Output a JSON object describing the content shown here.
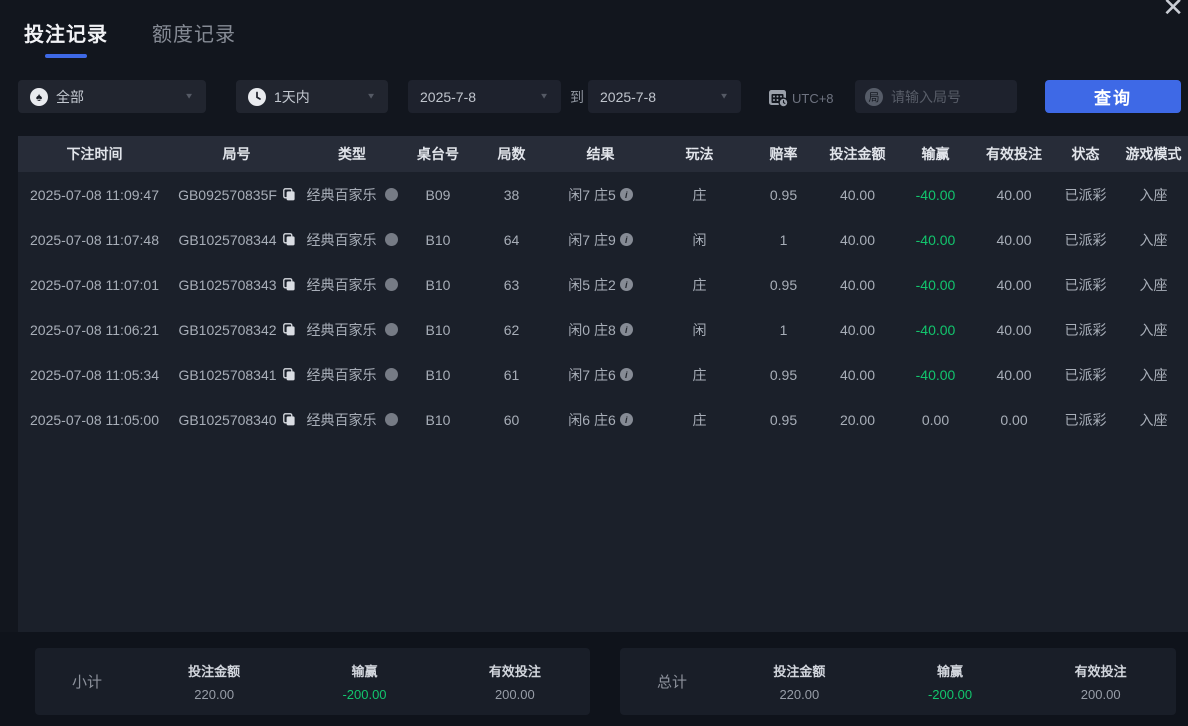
{
  "icons": {
    "close": "✕",
    "caret": "▼",
    "spade": "♠",
    "info": "i"
  },
  "colors": {
    "accent_blue": "#3e69e6",
    "loss_green": "#12c56d"
  },
  "tabs": [
    {
      "label": "投注记录",
      "active": true
    },
    {
      "label": "额度记录",
      "active": false
    }
  ],
  "filters": {
    "game_type_value": "全部",
    "time_range_value": "1天内",
    "date_from": "2025-7-8",
    "to_label": "到",
    "date_to": "2025-7-8",
    "timezone": "UTC+8",
    "round_icon_char": "局",
    "round_placeholder": "请输入局号",
    "query_label": "查询"
  },
  "table": {
    "headers": [
      "下注时间",
      "局号",
      "类型",
      "桌台号",
      "局数",
      "结果",
      "玩法",
      "赔率",
      "投注金额",
      "输赢",
      "有效投注",
      "状态",
      "游戏模式"
    ],
    "rows": [
      {
        "time": "2025-07-08 11:09:47",
        "round_id": "GB092570835F",
        "game_type": "经典百家乐",
        "table_no": "B09",
        "round_no": "38",
        "result": "闲7 庄5",
        "play": "庄",
        "odds": "0.95",
        "bet_amount": "40.00",
        "win_loss": "-40.00",
        "valid_bet": "40.00",
        "status": "已派彩",
        "mode": "入座"
      },
      {
        "time": "2025-07-08 11:07:48",
        "round_id": "GB1025708344",
        "game_type": "经典百家乐",
        "table_no": "B10",
        "round_no": "64",
        "result": "闲7 庄9",
        "play": "闲",
        "odds": "1",
        "bet_amount": "40.00",
        "win_loss": "-40.00",
        "valid_bet": "40.00",
        "status": "已派彩",
        "mode": "入座"
      },
      {
        "time": "2025-07-08 11:07:01",
        "round_id": "GB1025708343",
        "game_type": "经典百家乐",
        "table_no": "B10",
        "round_no": "63",
        "result": "闲5 庄2",
        "play": "庄",
        "odds": "0.95",
        "bet_amount": "40.00",
        "win_loss": "-40.00",
        "valid_bet": "40.00",
        "status": "已派彩",
        "mode": "入座"
      },
      {
        "time": "2025-07-08 11:06:21",
        "round_id": "GB1025708342",
        "game_type": "经典百家乐",
        "table_no": "B10",
        "round_no": "62",
        "result": "闲0 庄8",
        "play": "闲",
        "odds": "1",
        "bet_amount": "40.00",
        "win_loss": "-40.00",
        "valid_bet": "40.00",
        "status": "已派彩",
        "mode": "入座"
      },
      {
        "time": "2025-07-08 11:05:34",
        "round_id": "GB1025708341",
        "game_type": "经典百家乐",
        "table_no": "B10",
        "round_no": "61",
        "result": "闲7 庄6",
        "play": "庄",
        "odds": "0.95",
        "bet_amount": "40.00",
        "win_loss": "-40.00",
        "valid_bet": "40.00",
        "status": "已派彩",
        "mode": "入座"
      },
      {
        "time": "2025-07-08 11:05:00",
        "round_id": "GB1025708340",
        "game_type": "经典百家乐",
        "table_no": "B10",
        "round_no": "60",
        "result": "闲6 庄6",
        "play": "庄",
        "odds": "0.95",
        "bet_amount": "20.00",
        "win_loss": "0.00",
        "valid_bet": "0.00",
        "status": "已派彩",
        "mode": "入座"
      }
    ]
  },
  "summary": {
    "subtotal": {
      "label": "小计",
      "bet_label": "投注金额",
      "bet_value": "220.00",
      "win_label": "输赢",
      "win_value": "-200.00",
      "valid_label": "有效投注",
      "valid_value": "200.00"
    },
    "total": {
      "label": "总计",
      "bet_label": "投注金额",
      "bet_value": "220.00",
      "win_label": "输赢",
      "win_value": "-200.00",
      "valid_label": "有效投注",
      "valid_value": "200.00"
    }
  }
}
